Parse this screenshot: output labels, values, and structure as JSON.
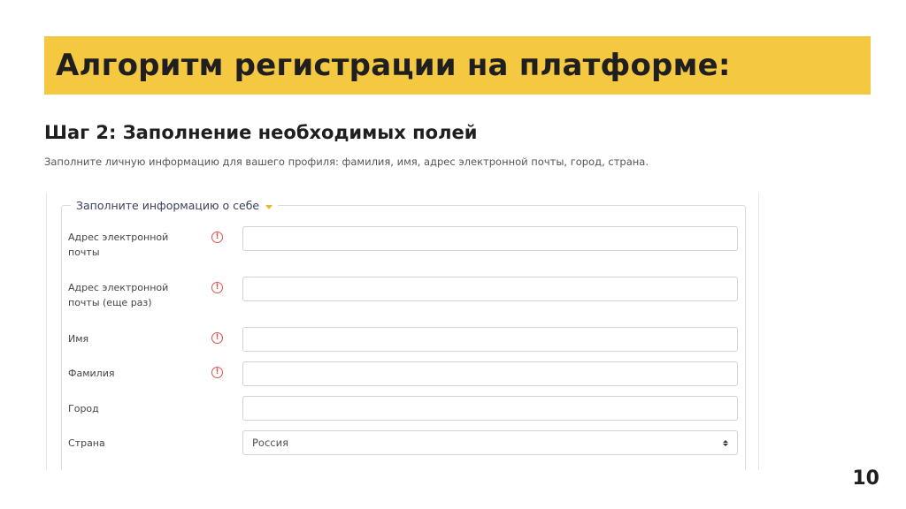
{
  "slide": {
    "title": "Алгоритм регистрации на платформе:",
    "step_title": "Шаг 2: Заполнение необходимых полей",
    "step_description": "Заполните личную информацию для вашего профиля: фамилия, имя, адрес электронной почты, город, страна.",
    "page_number": "10",
    "accent_color": "#f5c842"
  },
  "form": {
    "legend": "Заполните информацию о себе",
    "required_icon": "exclamation-circle-icon",
    "required_color": "#d9534f",
    "fields": [
      {
        "label": "Адрес электронной почты",
        "value": "",
        "required": true
      },
      {
        "label": "Адрес электронной почты (еще раз)",
        "value": "",
        "required": true
      },
      {
        "label": "Имя",
        "value": "",
        "required": true
      },
      {
        "label": "Фамилия",
        "value": "",
        "required": true
      },
      {
        "label": "Город",
        "value": "",
        "required": false
      },
      {
        "label": "Страна",
        "value": "Россия",
        "required": false,
        "type": "select"
      }
    ]
  }
}
